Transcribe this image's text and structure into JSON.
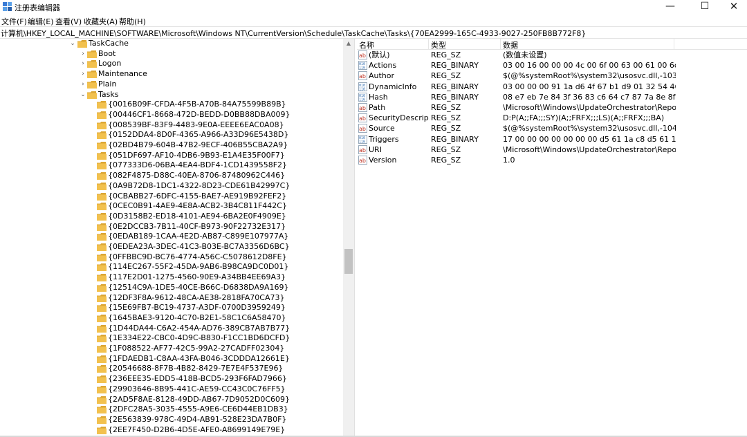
{
  "window": {
    "title": "注册表编辑器",
    "minimize": "—",
    "maximize": "☐",
    "close": "✕"
  },
  "menu": [
    "文件(F)",
    "编辑(E)",
    "查看(V)",
    "收藏夹(A)",
    "帮助(H)"
  ],
  "address": "计算机\\HKEY_LOCAL_MACHINE\\SOFTWARE\\Microsoft\\Windows NT\\CurrentVersion\\Schedule\\TaskCache\\Tasks\\{70EA2999-165C-4933-9027-250FB8B772F8}",
  "tree": {
    "root": "TaskCache",
    "children": [
      {
        "label": "Boot",
        "expanded": false
      },
      {
        "label": "Logon",
        "expanded": false
      },
      {
        "label": "Maintenance",
        "expanded": false
      },
      {
        "label": "Plain",
        "expanded": false
      },
      {
        "label": "Tasks",
        "expanded": true
      }
    ],
    "task_keys": [
      "{0016B09F-CFDA-4F5B-A70B-84A75599B89B}",
      "{00446CF1-8668-472D-BEDD-D0BB88DBA009}",
      "{008539BF-83F9-4483-9E0A-EEEE6EAC0A08}",
      "{0152DDA4-8D0F-4365-A966-A33D96E5438D}",
      "{02BD4B79-604B-47B2-9ECF-406B55CBA2A9}",
      "{051DF697-AF10-4DB6-9B93-E1A4E35F00F7}",
      "{077333D6-06BA-4EA4-BDF4-1CD1439558F2}",
      "{082F4875-D88C-40EA-8706-87480962C446}",
      "{0A9B72D8-1DC1-4322-8D23-CDE61B42997C}",
      "{0CBABB27-6DFC-4155-BAE7-AE919B92FEF2}",
      "{0CEC0B91-4AE9-4E8A-ACB2-3B4C811F442C}",
      "{0D3158B2-ED18-4101-AE94-6BA2E0F4909E}",
      "{0E2DCCB3-7B11-40CF-B973-90F22732E317}",
      "{0EDAB189-1CAA-4E2D-AB87-C899E107977A}",
      "{0EDEA23A-3DEC-41C3-B03E-BC7A3356D6BC}",
      "{0FFBBC9D-BC76-4774-A56C-C5078612D8FE}",
      "{114EC267-55F2-45DA-9AB6-B98CA9DC0D01}",
      "{117E2D01-1275-4560-90E9-A34BB4EE69A3}",
      "{12514C9A-1DE5-40CE-B66C-D6838DA9A169}",
      "{12DF3F8A-9612-48CA-AE38-2818FA70CA73}",
      "{15E69FB7-BC19-4737-A3DF-0700D3959249}",
      "{1645BAE3-9120-4C70-B2E1-58C1C6A58470}",
      "{1D44DA44-C6A2-454A-AD76-389CB7AB7B77}",
      "{1E334E22-CBC0-4D9C-B830-F1CC1BD6DCFD}",
      "{1F088522-AF77-42C5-99A2-27CADFF02304}",
      "{1FDAEDB1-C8AA-43FA-B046-3CDDDA12661E}",
      "{20546688-8F7B-4B82-8429-7E7E4F537E96}",
      "{236EEE35-EDD5-418B-BCD5-293F6FAD7966}",
      "{29903646-8B95-441C-AE59-CC43C0C76FF5}",
      "{2AD5F8AE-8128-49DD-AB67-7D9052D0C609}",
      "{2DFC28A5-3035-4555-A9E6-CE6D44EB1DB3}",
      "{2E563839-978C-49D4-AB91-528E23DA7B0F}",
      "{2EE7F450-D2B6-4D5E-AFE0-A8699149E79E}"
    ]
  },
  "list": {
    "headers": {
      "name": "名称",
      "type": "类型",
      "data": "数据"
    },
    "rows": [
      {
        "icon": "string-value-icon",
        "name": "(默认)",
        "type": "REG_SZ",
        "data": "(数值未设置)"
      },
      {
        "icon": "binary-value-icon",
        "name": "Actions",
        "type": "REG_BINARY",
        "data": "03 00 16 00 00 00 4c 00 6f 00 63 00 61 00 6c 00..."
      },
      {
        "icon": "string-value-icon",
        "name": "Author",
        "type": "REG_SZ",
        "data": "$(@%systemRoot%\\system32\\usosvc.dll,-103)"
      },
      {
        "icon": "binary-value-icon",
        "name": "DynamicInfo",
        "type": "REG_BINARY",
        "data": "03 00 00 00 91 1a d6 4f 67 b1 d9 01 32 54 46 f4..."
      },
      {
        "icon": "binary-value-icon",
        "name": "Hash",
        "type": "REG_BINARY",
        "data": "08 e7 eb 7e 84 3f 36 83 c6 64 c7 87 7a 8e 8f bd ..."
      },
      {
        "icon": "string-value-icon",
        "name": "Path",
        "type": "REG_SZ",
        "data": "\\Microsoft\\Windows\\UpdateOrchestrator\\Repo..."
      },
      {
        "icon": "string-value-icon",
        "name": "SecurityDescrip...",
        "type": "REG_SZ",
        "data": "D:P(A;;FA;;;SY)(A;;FRFX;;;LS)(A;;FRFX;;;BA)"
      },
      {
        "icon": "string-value-icon",
        "name": "Source",
        "type": "REG_SZ",
        "data": "$(@%systemRoot%\\system32\\usosvc.dll,-104)"
      },
      {
        "icon": "binary-value-icon",
        "name": "Triggers",
        "type": "REG_BINARY",
        "data": "17 00 00 00 00 00 00 00 d5 61 1a c8 d5 61 1..."
      },
      {
        "icon": "string-value-icon",
        "name": "URI",
        "type": "REG_SZ",
        "data": "\\Microsoft\\Windows\\UpdateOrchestrator\\Repo..."
      },
      {
        "icon": "string-value-icon",
        "name": "Version",
        "type": "REG_SZ",
        "data": "1.0"
      }
    ]
  },
  "colors": {
    "folder": "#f2c14e",
    "folder_dark": "#dca633",
    "string_icon": "#c0392b",
    "binary_icon": "#2e6bb0"
  }
}
